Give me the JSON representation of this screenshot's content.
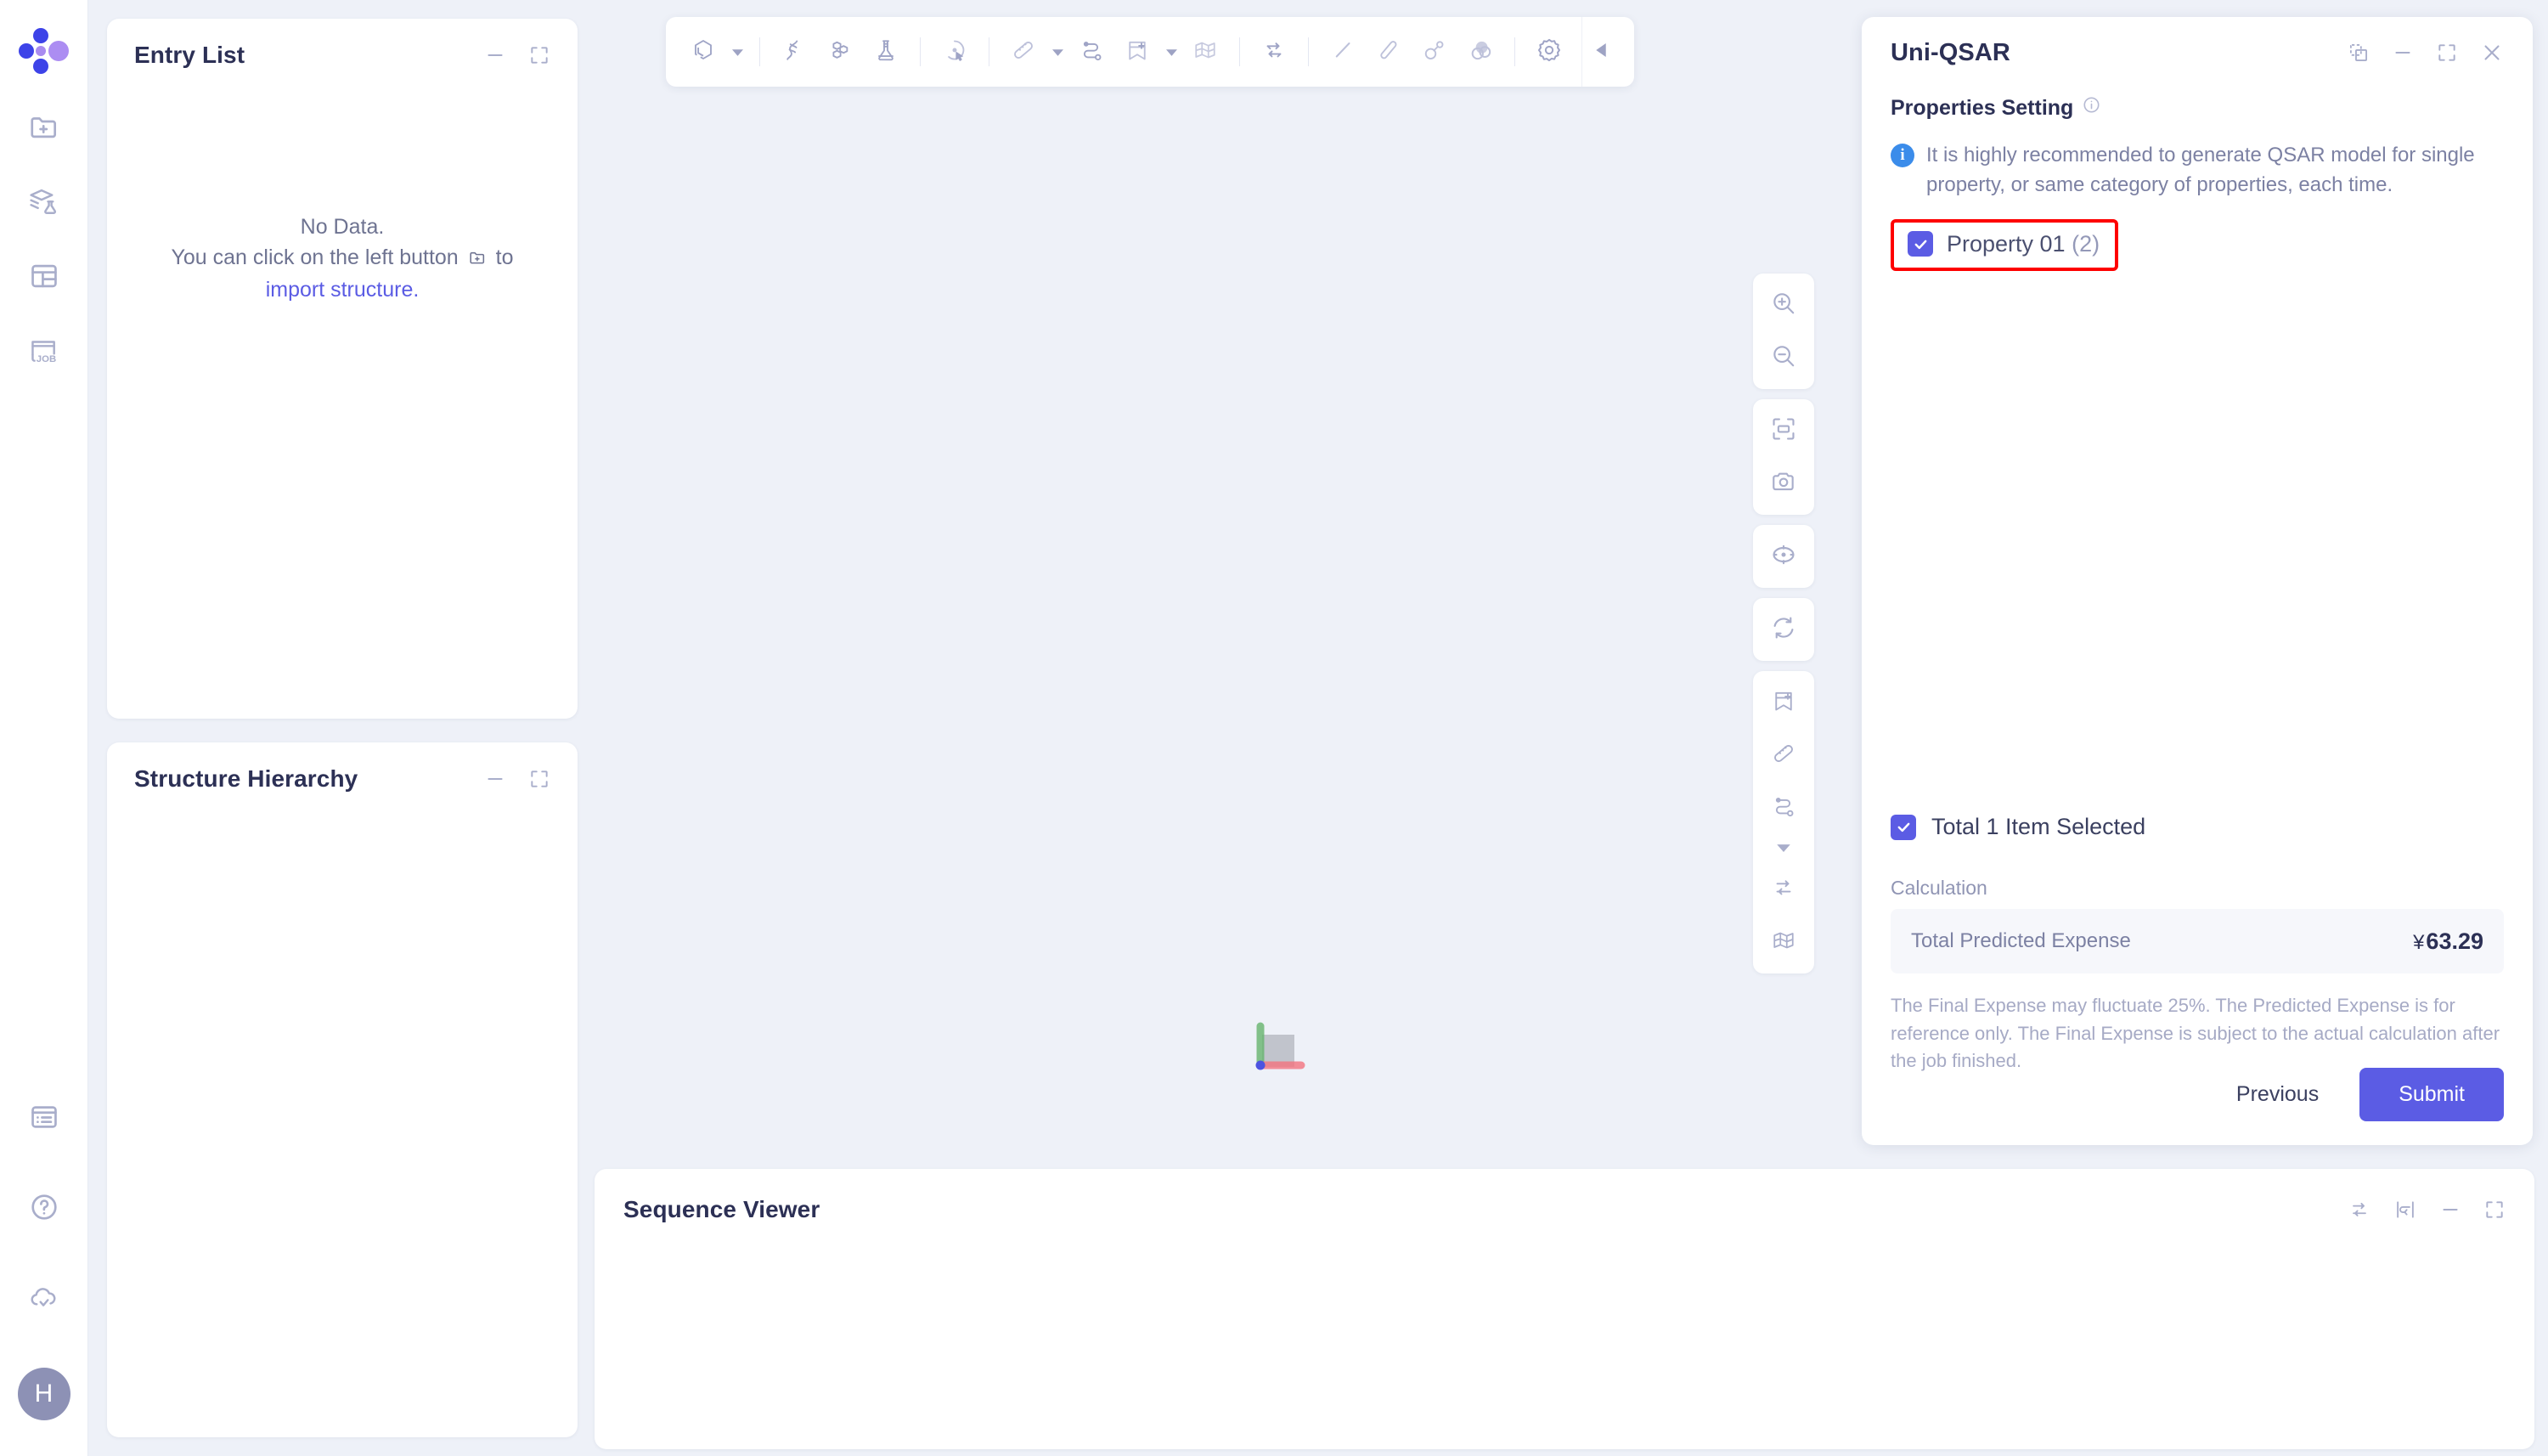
{
  "theme": {
    "accent": "#5b5ce4",
    "page_bg": "#eef1f8",
    "panel_bg": "#ffffff",
    "icon_muted": "#a9aecb",
    "title_color": "#2c3055",
    "highlight_border": "#fe0000",
    "info_blue": "#3b8cea"
  },
  "rail": {
    "logo_name": "app-logo",
    "items": [
      {
        "name": "import-structure-icon",
        "label": "Import Structure"
      },
      {
        "name": "library-flask-icon",
        "label": "Structure Library"
      },
      {
        "name": "table-layout-icon",
        "label": "Data Table"
      },
      {
        "name": "job-icon",
        "label": "JOB"
      }
    ],
    "bottom_items": [
      {
        "name": "notes-icon",
        "label": "Notes"
      },
      {
        "name": "help-icon",
        "label": "Help"
      },
      {
        "name": "cloud-check-icon",
        "label": "Cloud Sync"
      }
    ],
    "avatar_initial": "H"
  },
  "entry_list": {
    "title": "Entry List",
    "empty_line1": "No Data.",
    "empty_line2_pre": "You can click on the left button",
    "empty_line2_post": "to",
    "empty_link": "import structure.",
    "actions": [
      {
        "name": "minimize-icon",
        "label": "Minimize"
      },
      {
        "name": "maximize-icon",
        "label": "Maximize"
      }
    ]
  },
  "structure_hierarchy": {
    "title": "Structure Hierarchy",
    "actions": [
      {
        "name": "minimize-icon",
        "label": "Minimize"
      },
      {
        "name": "maximize-icon",
        "label": "Maximize"
      }
    ]
  },
  "sequence_viewer": {
    "title": "Sequence Viewer",
    "actions": [
      {
        "name": "swap-arrows-icon",
        "label": "Swap"
      },
      {
        "name": "wrap-line-icon",
        "label": "Wrap"
      },
      {
        "name": "minimize-icon",
        "label": "Minimize"
      },
      {
        "name": "maximize-icon",
        "label": "Maximize"
      }
    ]
  },
  "toolbar": {
    "items": [
      {
        "name": "benzene-ring-icon",
        "label": "Molecule",
        "caret": true
      },
      {
        "sep": true
      },
      {
        "name": "dna-helix-icon",
        "label": "DNA",
        "caret": false
      },
      {
        "name": "polycyclic-icon",
        "label": "Polycyclic",
        "caret": false
      },
      {
        "name": "flask-icon",
        "label": "Flask",
        "caret": false
      },
      {
        "sep": true
      },
      {
        "name": "select-atom-icon",
        "label": "Select Atom",
        "caret": false
      },
      {
        "sep": true
      },
      {
        "name": "ruler-icon",
        "label": "Measure",
        "caret": true
      },
      {
        "name": "path-node-icon",
        "label": "Path",
        "caret": false
      },
      {
        "name": "bookmark-add-icon",
        "label": "Add Bookmark",
        "caret": true
      },
      {
        "name": "mesh-surface-icon",
        "label": "Surface",
        "caret": false
      },
      {
        "sep": true
      },
      {
        "name": "swap-arrows-icon",
        "label": "Swap",
        "caret": false
      },
      {
        "sep": true
      },
      {
        "name": "line-icon",
        "label": "Line",
        "caret": false
      },
      {
        "name": "stick-icon",
        "label": "Stick",
        "caret": false
      },
      {
        "name": "ball-stick-icon",
        "label": "Ball and Stick",
        "caret": false
      },
      {
        "name": "spacefill-icon",
        "label": "Spacefill",
        "caret": false
      },
      {
        "sep": true
      },
      {
        "name": "gear-icon",
        "label": "Settings",
        "caret": false
      }
    ],
    "collapse_name": "collapse-toolbar-icon"
  },
  "view_tools": {
    "groups": [
      {
        "items": [
          {
            "name": "zoom-in-icon",
            "label": "Zoom In"
          },
          {
            "name": "zoom-out-icon",
            "label": "Zoom Out"
          }
        ]
      },
      {
        "items": [
          {
            "name": "fit-to-screen-icon",
            "label": "Fit to Screen"
          },
          {
            "name": "camera-icon",
            "label": "Screenshot"
          }
        ]
      },
      {
        "items": [
          {
            "name": "center-target-icon",
            "label": "Center"
          }
        ]
      },
      {
        "items": [
          {
            "name": "refresh-icon",
            "label": "Reset View"
          }
        ]
      },
      {
        "items": [
          {
            "name": "bookmark-add-icon",
            "label": "Add Bookmark"
          },
          {
            "name": "ruler-icon",
            "label": "Measure"
          },
          {
            "name": "path-node-icon",
            "label": "Path"
          },
          {
            "name": "chevron-down-icon",
            "label": "More"
          },
          {
            "name": "swap-arrows-icon",
            "label": "Swap"
          },
          {
            "name": "mesh-surface-icon",
            "label": "Surface"
          }
        ]
      }
    ]
  },
  "uni_qsar": {
    "title": "Uni-QSAR",
    "header_actions": [
      {
        "name": "popout-icon",
        "label": "Pop Out"
      },
      {
        "name": "minimize-icon",
        "label": "Minimize"
      },
      {
        "name": "maximize-icon",
        "label": "Maximize"
      },
      {
        "name": "close-icon",
        "label": "Close"
      }
    ],
    "section_title": "Properties Setting",
    "section_info_icon": "info-circle-icon",
    "note": "It is highly recommended to generate QSAR model for single property, or same category of properties, each time.",
    "property": {
      "label": "Property 01",
      "count": "(2)",
      "checked": true
    },
    "total_selected_label": "Total 1 Item Selected",
    "total_selected_checked": true,
    "calculation_label": "Calculation",
    "expense_label": "Total Predicted Expense",
    "expense_currency": "¥",
    "expense_value": "63.29",
    "disclaimer": "The Final Expense may fluctuate 25%. The Predicted Expense is for reference only. The Final Expense is subject to the actual calculation after the job finished.",
    "previous_label": "Previous",
    "submit_label": "Submit"
  },
  "viewport": {
    "axis_gizmo_name": "axis-orientation-gizmo",
    "axes": [
      {
        "name": "x-axis",
        "color": "#f4747f"
      },
      {
        "name": "y-axis",
        "color": "#66b56e"
      },
      {
        "name": "z-axis",
        "color": "#4d53e0"
      }
    ]
  }
}
